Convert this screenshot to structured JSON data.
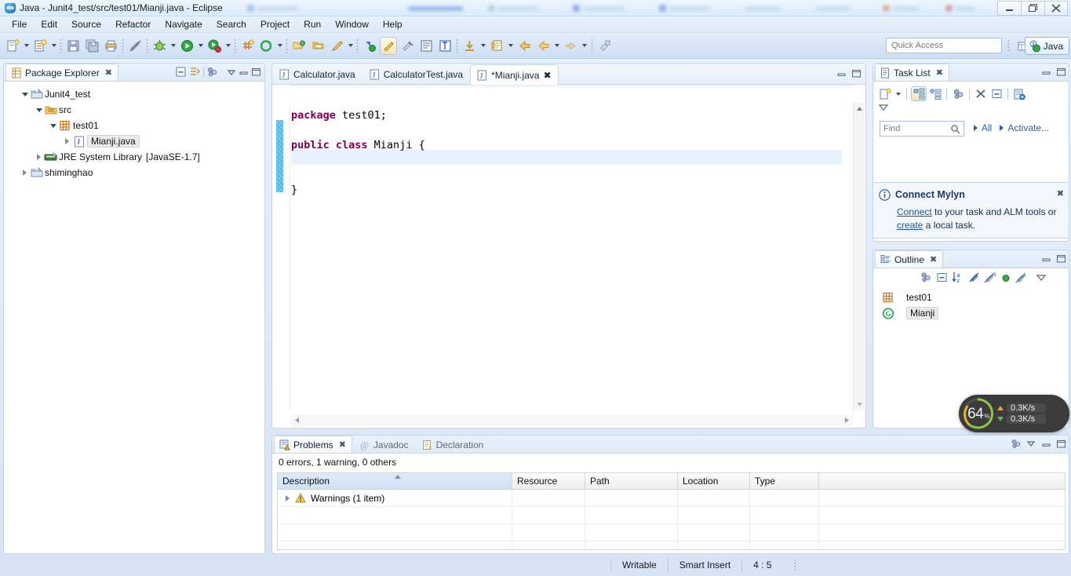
{
  "window": {
    "title": "Java - Junit4_test/src/test01/Mianji.java - Eclipse",
    "app_icon": "eclipse-icon",
    "controls": {
      "minimize": "–",
      "restore": "❐",
      "close": "✕"
    }
  },
  "menubar": {
    "items": [
      "File",
      "Edit",
      "Source",
      "Refactor",
      "Navigate",
      "Search",
      "Project",
      "Run",
      "Window",
      "Help"
    ]
  },
  "toolbar": {
    "quick_access_placeholder": "Quick Access",
    "perspective_label": "Java",
    "icons": [
      "new-wizard-icon",
      "new-dropdown-arrow",
      "new-java-class-icon",
      "new-java-dropdown-arrow",
      "save-icon",
      "save-all-icon",
      "print-icon",
      "toggle-markoccurrences-icon",
      "debug-icon",
      "debug-dropdown-arrow",
      "run-icon",
      "run-dropdown-arrow",
      "coverage-icon",
      "coverage-dropdown-arrow",
      "new-junit-test-icon",
      "external-tools-icon",
      "external-tools-dropdown-arrow",
      "open-type-icon",
      "open-task-icon",
      "search-icon",
      "search-dropdown-arrow",
      "next-annotation-icon",
      "previous-annotation-icon",
      "last-edit-location-icon",
      "back-icon",
      "back-dropdown-arrow",
      "forward-icon",
      "forward-dropdown-arrow",
      "pin-editor-icon",
      "new-perspective-icon",
      "java-perspective-icon"
    ]
  },
  "package_explorer": {
    "tab_label": "Package Explorer",
    "tab_icon": "package-explorer-icon",
    "close_icon": "close-icon",
    "toolbar_icons": [
      "collapse-all-icon",
      "link-with-editor-icon",
      "view-menu-icon",
      "minimize-icon",
      "maximize-icon"
    ],
    "tree": [
      {
        "label": "Junit4_test",
        "icon": "java-project-icon",
        "indent": 0,
        "twisty": "down",
        "selected": false
      },
      {
        "label": "src",
        "icon": "source-folder-icon",
        "indent": 1,
        "twisty": "down",
        "selected": false
      },
      {
        "label": "test01",
        "icon": "package-icon",
        "indent": 2,
        "twisty": "down",
        "selected": false
      },
      {
        "label": "Mianji.java",
        "icon": "java-file-icon",
        "indent": 3,
        "twisty": "right",
        "selected": true
      },
      {
        "label": "JRE System Library",
        "suffix": "[JavaSE-1.7]",
        "icon": "jre-library-icon",
        "indent": 1,
        "twisty": "right",
        "selected": false
      },
      {
        "label": "shiminghao",
        "icon": "java-project-icon",
        "indent": 0,
        "twisty": "right",
        "selected": false
      }
    ]
  },
  "editor": {
    "tabs": [
      {
        "label": "Calculator.java",
        "icon": "java-file-icon",
        "active": false,
        "dirty": false
      },
      {
        "label": "CalculatorTest.java",
        "icon": "java-file-icon",
        "active": false,
        "dirty": false
      },
      {
        "label": "*Mianji.java",
        "icon": "java-file-icon",
        "active": true,
        "dirty": true,
        "close_icon": "close-icon"
      }
    ],
    "controls": [
      "minimize-icon",
      "maximize-icon"
    ],
    "code_lines": [
      {
        "tokens": [
          {
            "t": "package",
            "k": true
          },
          {
            "t": " test01;",
            "k": false
          }
        ]
      },
      {
        "tokens": []
      },
      {
        "tokens": [
          {
            "t": "public class",
            "k": true
          },
          {
            "t": " Mianji {",
            "k": false
          }
        ]
      },
      {
        "tokens": [],
        "current": true
      },
      {
        "tokens": []
      },
      {
        "tokens": [
          {
            "t": "}",
            "k": false
          }
        ]
      }
    ]
  },
  "problems": {
    "tabs": [
      {
        "label": "Problems",
        "icon": "problems-icon",
        "active": true,
        "close_icon": "close-icon"
      },
      {
        "label": "Javadoc",
        "icon": "javadoc-icon",
        "active": false
      },
      {
        "label": "Declaration",
        "icon": "declaration-icon",
        "active": false
      }
    ],
    "summary": "0 errors, 1 warning, 0 others",
    "columns": [
      "Description",
      "Resource",
      "Path",
      "Location",
      "Type"
    ],
    "rows": [
      {
        "description": "Warnings (1 item)",
        "resource": "",
        "path": "",
        "location": "",
        "type": "",
        "icon": "warning-icon",
        "twisty": "right"
      },
      {
        "description": "",
        "resource": "",
        "path": "",
        "location": "",
        "type": ""
      },
      {
        "description": "",
        "resource": "",
        "path": "",
        "location": "",
        "type": ""
      },
      {
        "description": "",
        "resource": "",
        "path": "",
        "location": "",
        "type": ""
      }
    ]
  },
  "task_list": {
    "tab_label": "Task List",
    "tab_icon": "task-list-icon",
    "close_icon": "close-icon",
    "toolbar_icons": [
      "new-task-icon",
      "new-task-dropdown-arrow",
      "categorized-presentation-icon",
      "scheduled-presentation-icon",
      "focus-on-workweek-icon",
      "synchronize-changed-icon",
      "collapse-all-icon",
      "task-repositories-icon",
      "view-menu-icon"
    ],
    "find_placeholder": "Find",
    "find_icon": "search-icon",
    "filter_all": "All",
    "filter_activate": "Activate..."
  },
  "mylyn_banner": {
    "icon": "info-icon",
    "title": "Connect Mylyn",
    "link_connect": "Connect",
    "text_mid": " to your task and ALM tools or ",
    "link_create": "create",
    "text_end": " a local task.",
    "close_icon": "close-icon"
  },
  "outline": {
    "tab_label": "Outline",
    "tab_icon": "outline-icon",
    "close_icon": "close-icon",
    "toolbar_icons": [
      "sort-icon",
      "collapse-all-icon",
      "sort-az-icon",
      "hide-fields-icon",
      "hide-static-icon",
      "hide-nonpublic-icon",
      "hide-local-types-icon",
      "view-menu-icon"
    ],
    "controls": [
      "minimize-icon",
      "maximize-icon"
    ],
    "tree": [
      {
        "label": "test01",
        "icon": "package-icon",
        "selected": false
      },
      {
        "label": "Mianji",
        "icon": "class-icon",
        "selected": true
      }
    ]
  },
  "perf_widget": {
    "cpu_percent": "64",
    "percent_symbol": "%",
    "upload": "0.3K/s",
    "download": "0.3K/s",
    "upload_icon": "arrow-up-icon",
    "download_icon": "arrow-down-icon",
    "ring_color": "#8ec63f",
    "ring_color_2": "#e0b32a"
  },
  "statusbar": {
    "writable": "Writable",
    "insert_mode": "Smart Insert",
    "cursor_position": "4 : 5"
  },
  "colors": {
    "keyword": "#7f0055",
    "accent": "#2a5fa8",
    "panel_border": "#c3d5ea",
    "chrome_top": "#eaf2fb"
  }
}
